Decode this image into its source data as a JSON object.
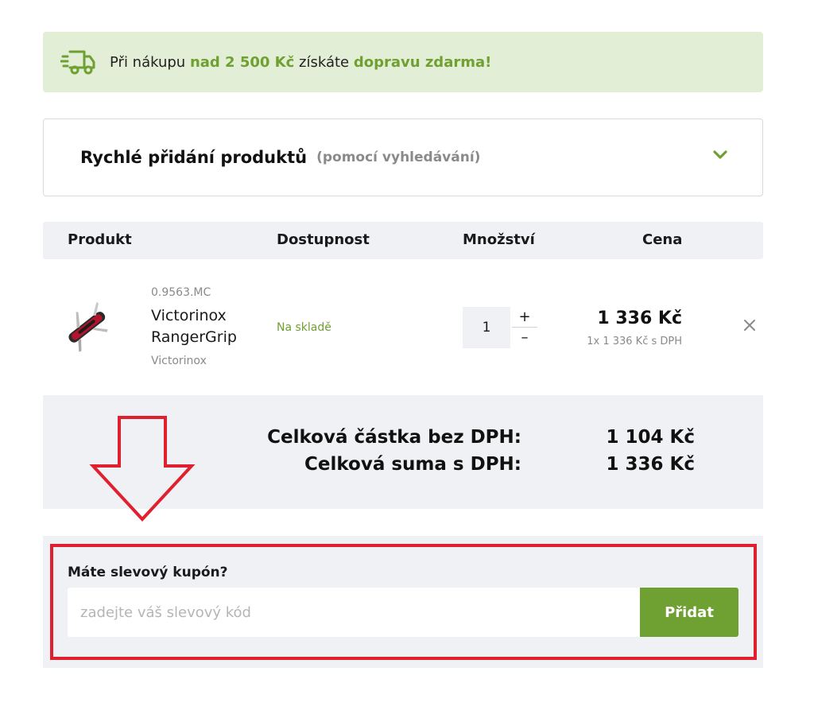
{
  "banner": {
    "icon": "truck-icon",
    "text_before": "Při nákupu ",
    "threshold": "nad 2 500 Kč",
    "text_middle": " získáte ",
    "benefit": "dopravu zdarma!"
  },
  "quick_add": {
    "title": "Rychlé přidání produktů",
    "hint": "(pomocí vyhledávání)",
    "toggle_icon": "chevron-down-icon"
  },
  "table": {
    "headers": {
      "product": "Produkt",
      "availability": "Dostupnost",
      "quantity": "Množství",
      "price": "Cena"
    },
    "items": [
      {
        "code": "0.9563.MC",
        "name": "Victorinox RangerGrip",
        "brand": "Victorinox",
        "availability": "Na skladě",
        "quantity": "1",
        "plus": "+",
        "minus": "–",
        "price": "1 336 Kč",
        "unit_price": "1x 1 336 Kč s DPH",
        "remove_icon": "close-icon"
      }
    ]
  },
  "totals": {
    "without_vat_label": "Celková částka bez DPH:",
    "without_vat_value": "1 104 Kč",
    "with_vat_label": "Celková suma s DPH:",
    "with_vat_value": "1 336 Kč"
  },
  "coupon": {
    "label": "Máte slevový kupón?",
    "placeholder": "zadejte váš slevový kód",
    "value": "",
    "button": "Přidat"
  },
  "colors": {
    "accent_green": "#6fa032",
    "banner_bg": "#e3eed6",
    "panel_bg": "#f0f1f5",
    "annotation_red": "#e0202e"
  }
}
